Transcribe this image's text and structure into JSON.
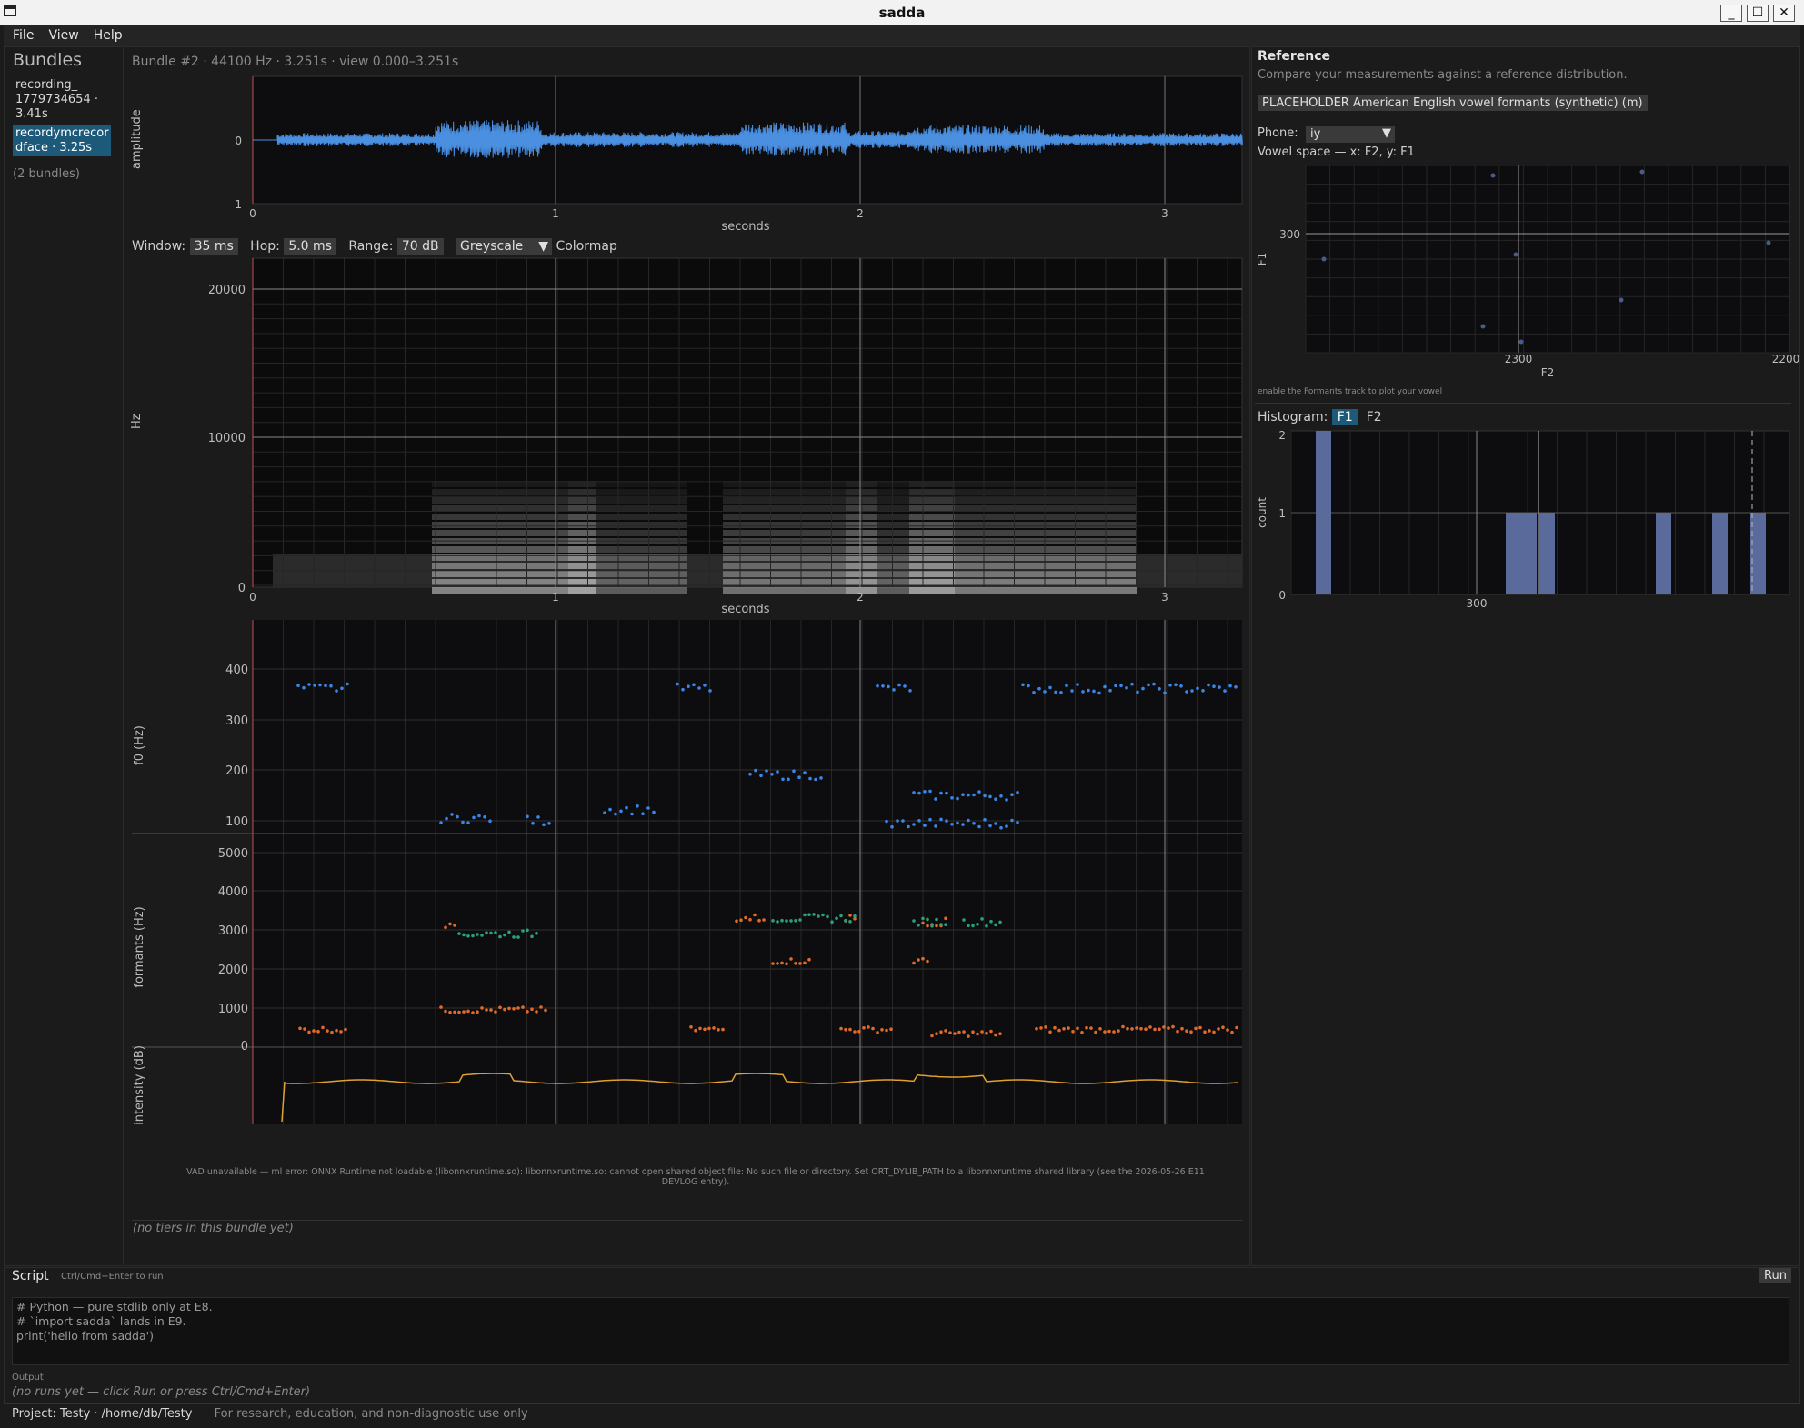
{
  "window": {
    "title": "sadda"
  },
  "menu": [
    "File",
    "View",
    "Help"
  ],
  "sidebar": {
    "title": "Bundles",
    "items": [
      {
        "line1": "recording_",
        "line2": "1779734654 ·",
        "line3": "3.41s",
        "selected": false
      },
      {
        "line1": "recordymcrecor",
        "line2": "dface · 3.25s",
        "line3": "",
        "selected": true
      }
    ],
    "count_label": "(2 bundles)"
  },
  "bundle_header": "Bundle #2 · 44100 Hz · 3.251s · view 0.000–3.251s",
  "waveform": {
    "ylabel": "amplitude",
    "xlabel": "seconds",
    "y_ticks": [
      "0",
      "-1"
    ],
    "x_ticks": [
      "0",
      "1",
      "2",
      "3"
    ]
  },
  "spectrogram_controls": {
    "window_label": "Window:",
    "window_value": "35 ms",
    "hop_label": "Hop:",
    "hop_value": "5.0 ms",
    "range_label": "Range:",
    "range_value": "70 dB",
    "colormap_value": "Greyscale",
    "colormap_label": "Colormap"
  },
  "spectrogram": {
    "ylabel": "Hz",
    "xlabel": "seconds",
    "y_ticks": [
      "20000",
      "10000",
      "0"
    ],
    "x_ticks": [
      "0",
      "1",
      "2",
      "3"
    ]
  },
  "f0_track": {
    "ylabel": "f0 (Hz)",
    "y_ticks": [
      "400",
      "300",
      "200",
      "100"
    ]
  },
  "formants_track": {
    "ylabel": "formants (Hz)",
    "y_ticks": [
      "5000",
      "4000",
      "3000",
      "2000",
      "1000",
      "0"
    ]
  },
  "intensity_track": {
    "ylabel": "intensity (dB)"
  },
  "vad_message": "VAD unavailable — ml error: ONNX Runtime not loadable (libonnxruntime.so): libonnxruntime.so: cannot open shared object file: No such file or directory. Set ORT_DYLIB_PATH to a libonnxruntime shared library (see the 2026-05-26 E11 DEVLOG entry).",
  "tiers_message": "(no tiers in this bundle yet)",
  "reference": {
    "title": "Reference",
    "subtitle": "Compare your measurements against a reference distribution.",
    "dataset": "PLACEHOLDER American English vowel formants (synthetic) (m)",
    "phone_label": "Phone:",
    "phone_value": "iy",
    "vowel_space_label": "Vowel space — x: F2, y: F1",
    "vowel_y_label": "F1",
    "vowel_x_label": "F2",
    "vowel_y_ticks": [
      "300"
    ],
    "vowel_x_ticks": [
      "2300",
      "2200"
    ],
    "vowel_hint": "enable the Formants track to plot your vowel",
    "histogram_label": "Histogram:",
    "histogram_tabs": [
      "F1",
      "F2"
    ],
    "histogram_ylabel": "count",
    "histogram_y_ticks": [
      "2",
      "1",
      "0"
    ],
    "histogram_x_ticks": [
      "300"
    ]
  },
  "script": {
    "tab": "Script",
    "hint": "Ctrl/Cmd+Enter to run",
    "run_label": "Run",
    "code_lines": [
      "# Python — pure stdlib only at E8.",
      "# `import sadda` lands in E9.",
      "print('hello from sadda')"
    ],
    "output_label": "Output",
    "output_placeholder": "(no runs yet — click Run or press Ctrl/Cmd+Enter)"
  },
  "statusbar": {
    "project": "Project: Testy · /home/db/Testy",
    "disclaimer": "For research, education, and non-diagnostic use only"
  },
  "colors": {
    "accent": "#1d5a7a",
    "wave": "#4a8fe0",
    "f0": "#3a86e8",
    "f1": "#e06a2a",
    "f2": "#2aa07a",
    "intensity": "#e0a030",
    "hist": "#5a6a9a"
  }
}
